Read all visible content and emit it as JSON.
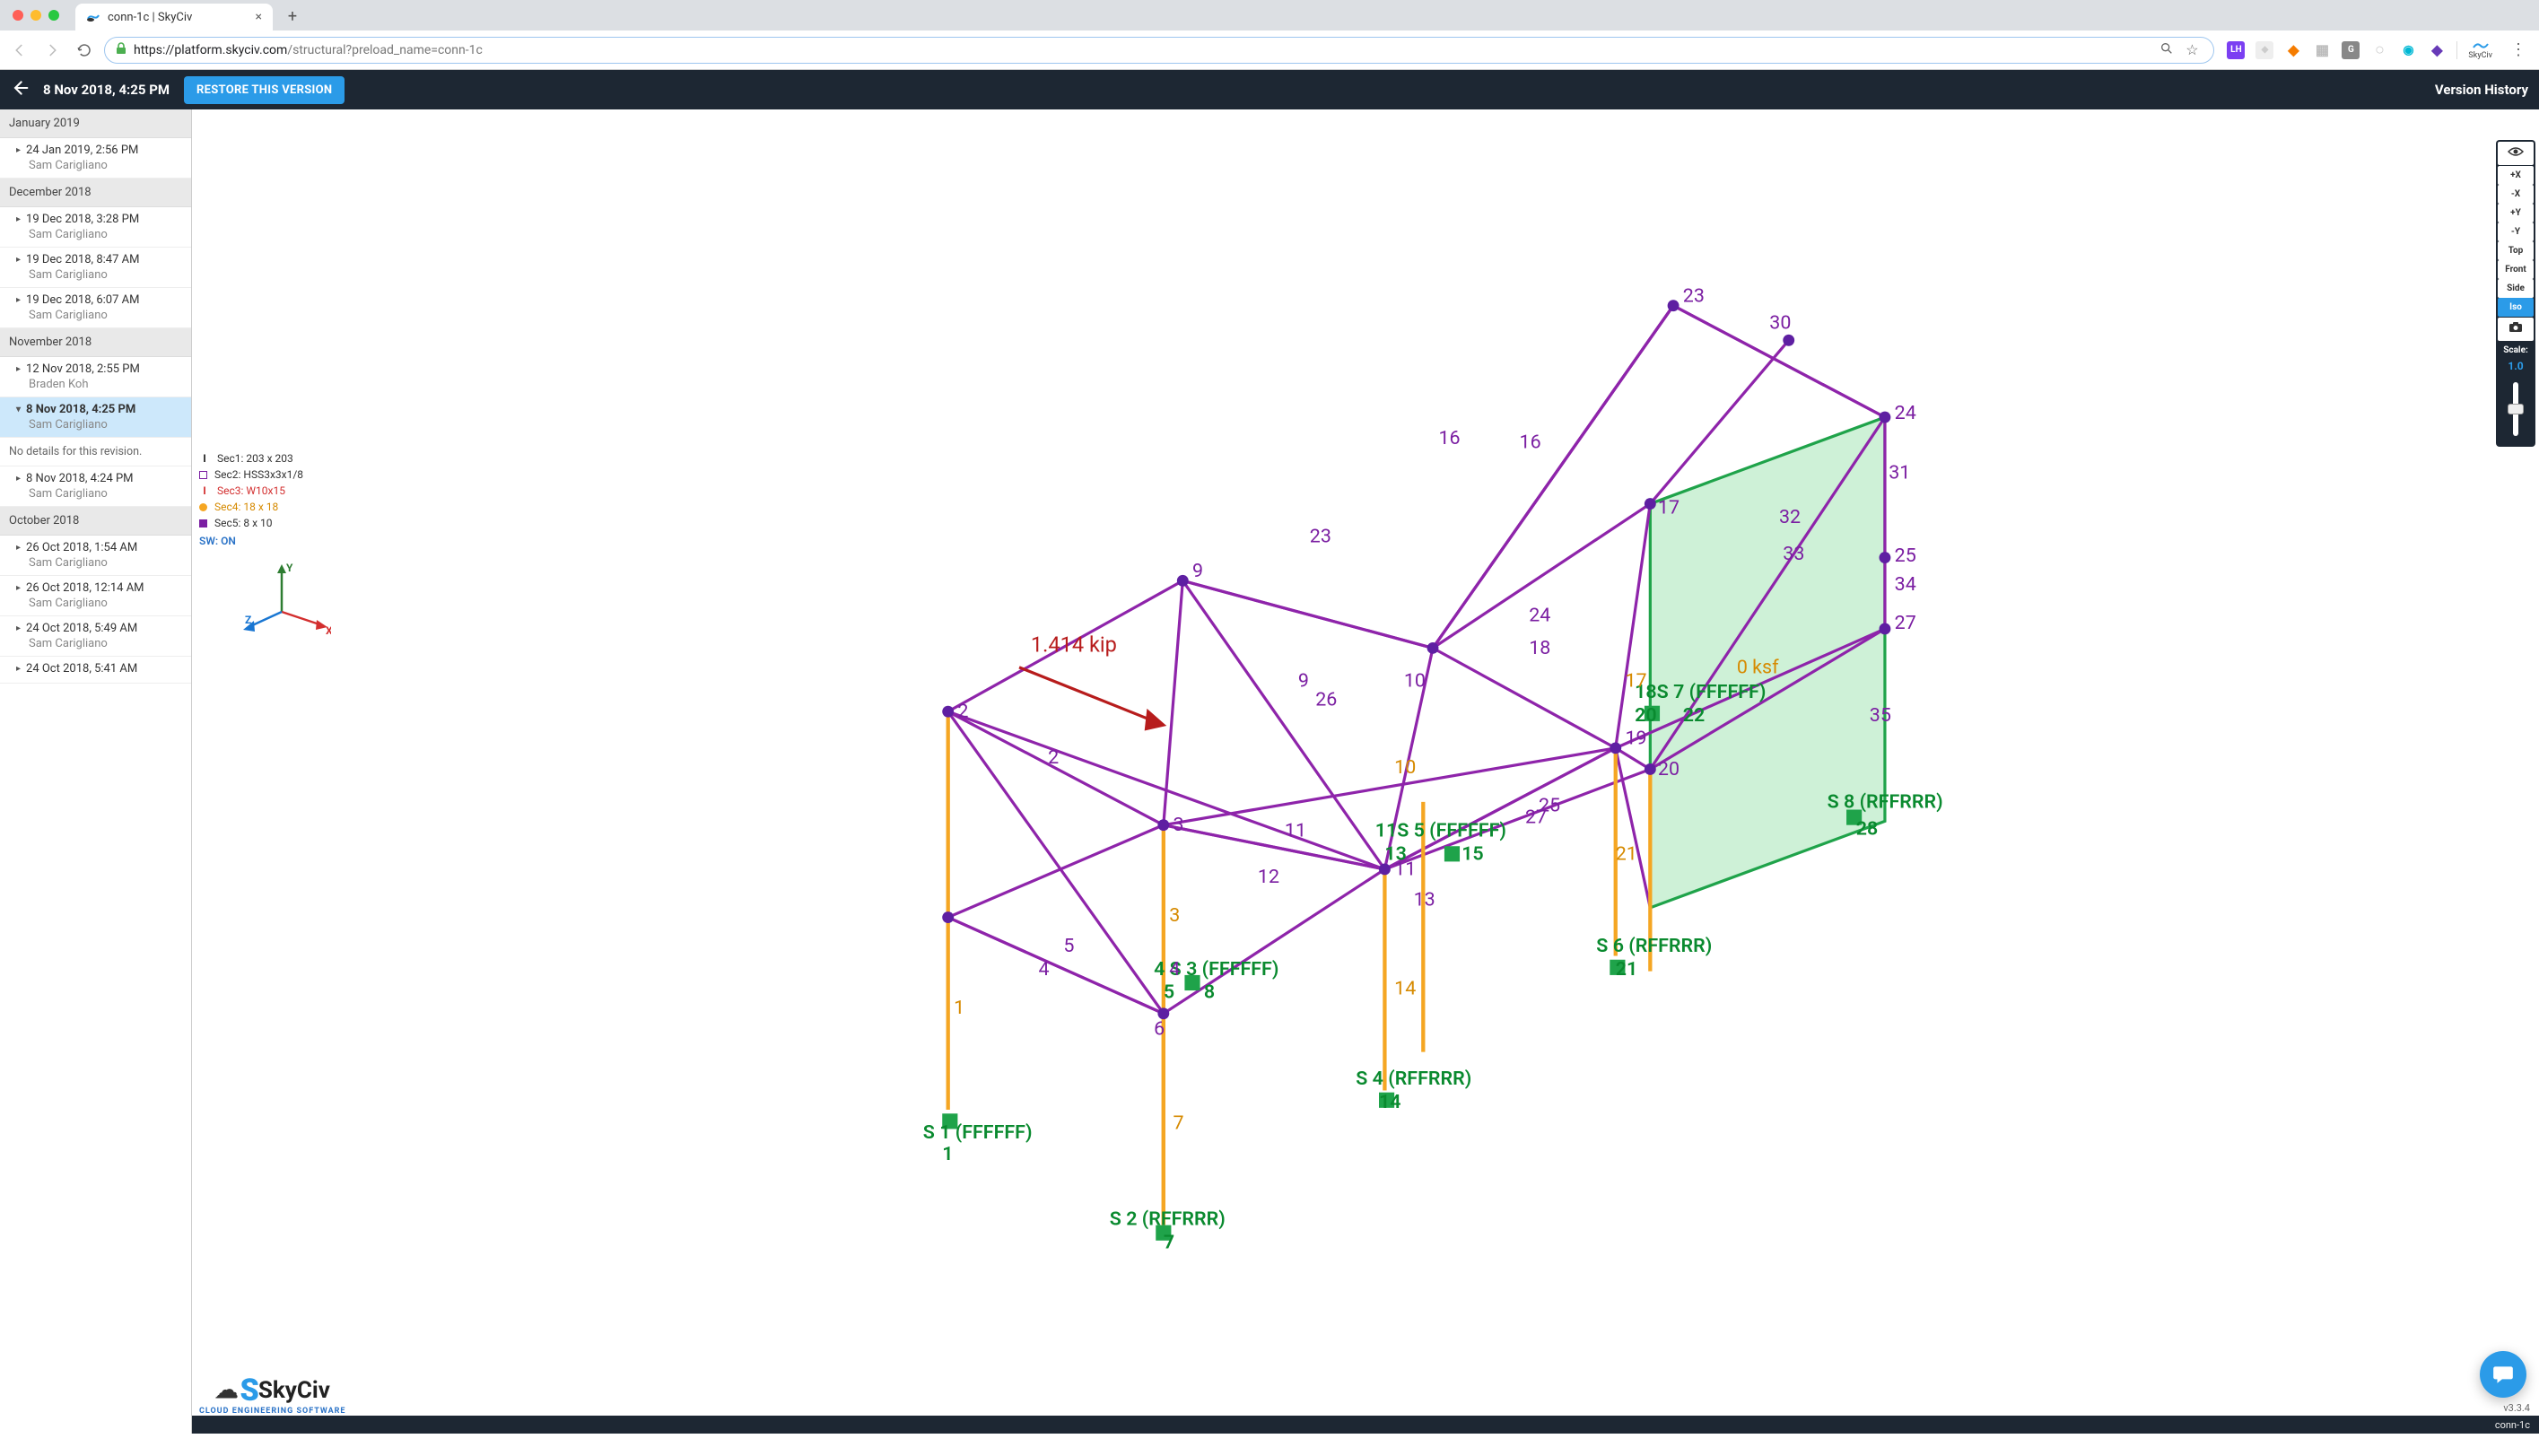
{
  "browser": {
    "tab_title": "conn-1c | SkyCiv",
    "url_host": "https://platform.skyciv.com",
    "url_path": "/structural?preload_name=conn-1c",
    "ext_badge": "LH",
    "ext_label": "SkyCiv"
  },
  "header": {
    "timestamp": "8 Nov 2018, 4:25 PM",
    "restore_label": "RESTORE THIS VERSION",
    "title_right": "Version History"
  },
  "revisions": {
    "no_details": "No details for this revision.",
    "groups": [
      {
        "month": "January 2019",
        "items": [
          {
            "date": "24 Jan 2019, 2:56 PM",
            "author": "Sam Carigliano"
          }
        ]
      },
      {
        "month": "December 2018",
        "items": [
          {
            "date": "19 Dec 2018, 3:28 PM",
            "author": "Sam Carigliano"
          },
          {
            "date": "19 Dec 2018, 8:47 AM",
            "author": "Sam Carigliano"
          },
          {
            "date": "19 Dec 2018, 6:07 AM",
            "author": "Sam Carigliano"
          }
        ]
      },
      {
        "month": "November 2018",
        "items": [
          {
            "date": "12 Nov 2018, 2:55 PM",
            "author": "Braden Koh"
          },
          {
            "date": "8 Nov 2018, 4:25 PM",
            "author": "Sam Carigliano",
            "selected": true,
            "expanded": true
          },
          {
            "date": "8 Nov 2018, 4:24 PM",
            "author": "Sam Carigliano"
          }
        ]
      },
      {
        "month": "October 2018",
        "items": [
          {
            "date": "26 Oct 2018, 1:54 AM",
            "author": "Sam Carigliano"
          },
          {
            "date": "26 Oct 2018, 12:14 AM",
            "author": "Sam Carigliano"
          },
          {
            "date": "24 Oct 2018, 5:49 AM",
            "author": "Sam Carigliano"
          },
          {
            "date": "24 Oct 2018, 5:41 AM",
            "author": ""
          }
        ]
      }
    ]
  },
  "legend": {
    "sec1": "Sec1: 203 x 203",
    "sec2": "Sec2: HSS3x3x1/8",
    "sec3": "Sec3: W10x15",
    "sec4": "Sec4: 18 x 18",
    "sec5": "Sec5: 8 x 10",
    "sw": "SW: ON"
  },
  "view": {
    "buttons": [
      "+X",
      "-X",
      "+Y",
      "-Y",
      "Top",
      "Front",
      "Side",
      "Iso"
    ],
    "active": "Iso",
    "scale_label": "Scale:",
    "scale_value": "1.0"
  },
  "logo": {
    "name": "SkyCiv",
    "tagline": "CLOUD ENGINEERING SOFTWARE"
  },
  "footer": {
    "version": "v3.3.4",
    "filename": "conn-1c"
  },
  "axes": {
    "x": "X",
    "y": "Y",
    "z": "Z"
  },
  "model_labels": {
    "load": "1.414 kip",
    "pressure": "0 ksf",
    "s1": "S 1 (FFFFFF)",
    "s2": "S 2 (RFFRRR)",
    "s3": "4 S 3 (FFFFFF)",
    "s4": "S 4 (RFFRRR)",
    "s5": "11S 5 (FFFFFF)",
    "s6": "S 6 (RFFRRR)",
    "s7": "18S 7 (FFFFFF)",
    "s8": "S 8 (RFFRRR)"
  }
}
